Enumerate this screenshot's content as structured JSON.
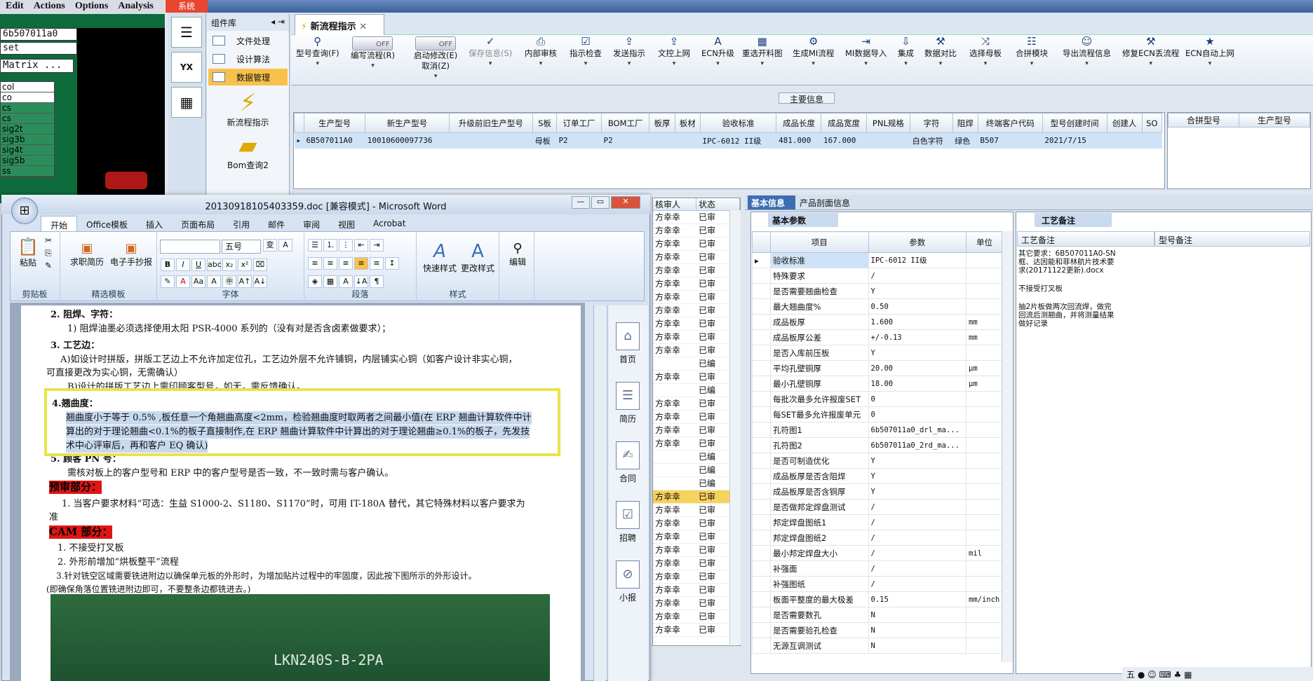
{
  "cam": {
    "menu": [
      "Edit",
      "Actions",
      "Options",
      "Analysis"
    ],
    "field1": "6b507011a0",
    "field2": "set",
    "field3": "Matrix ...",
    "layers": [
      "col",
      "co",
      "cs",
      "cs",
      "sig2t",
      "sig3b",
      "sig4t",
      "sig5b",
      "ss"
    ]
  },
  "app": {
    "sys_tab": "系统",
    "component_lib": "组件库",
    "items": [
      "文件处理",
      "设计算法",
      "数据管理"
    ],
    "big1": "新流程指示",
    "big2": "Bom查询2",
    "tab_title": "新流程指示"
  },
  "toolbar": [
    {
      "label": "型号查询(F)",
      "icon": "⚲"
    },
    {
      "label": "编写流程(R)",
      "icon": "toggle"
    },
    {
      "label": "启动修改(E)",
      "sub": "取消(Z)",
      "icon": "toggle"
    },
    {
      "label": "保存信息(S)",
      "icon": "✓"
    },
    {
      "label": "内部审核",
      "icon": "⎙"
    },
    {
      "label": "指示检查",
      "icon": "☑"
    },
    {
      "label": "发送指示",
      "icon": "⇪"
    },
    {
      "label": "文控上网",
      "icon": "⇪"
    },
    {
      "label": "ECN升级",
      "icon": "A"
    },
    {
      "label": "重选开料图",
      "icon": "▦"
    },
    {
      "label": "生成MI流程",
      "icon": "⚙"
    },
    {
      "label": "MI数据导入",
      "icon": "⇥"
    },
    {
      "label": "集成",
      "icon": "⇩"
    },
    {
      "label": "数据对比",
      "icon": "⚒"
    },
    {
      "label": "选择母板",
      "icon": "⤨"
    },
    {
      "label": "合拼模块",
      "icon": "☷"
    },
    {
      "label": "导出流程信息",
      "icon": "☺"
    },
    {
      "label": "修复ECN丢流程",
      "icon": "⚒"
    },
    {
      "label": "ECN自动上网",
      "icon": "★"
    }
  ],
  "toggle_off": "OFF",
  "main_info": {
    "header": "主要信息",
    "columns": [
      "生产型号",
      "新生产型号",
      "升级前旧生产型号",
      "S板",
      "订单工厂",
      "BOM工厂",
      "板厚",
      "板材",
      "验收标准",
      "成品长度",
      "成品宽度",
      "PNL规格",
      "字符",
      "阻焊",
      "终端客户代码",
      "型号创建时间",
      "创建人",
      "SO"
    ],
    "row": [
      "6B507011A0",
      "10010600097736",
      "",
      "母板",
      "P2",
      "P2",
      "",
      "",
      "IPC-6012 II级",
      "481.000",
      "167.000",
      "",
      "白色字符",
      "绿色",
      "B507",
      "2021/7/15",
      "",
      ""
    ]
  },
  "merge": {
    "columns": [
      "合拼型号",
      "生产型号"
    ]
  },
  "reviewers": {
    "columns": [
      "核审人",
      "状态"
    ],
    "rows": [
      [
        "方幸幸",
        "已审"
      ],
      [
        "方幸幸",
        "已审"
      ],
      [
        "方幸幸",
        "已审"
      ],
      [
        "方幸幸",
        "已审"
      ],
      [
        "方幸幸",
        "已审"
      ],
      [
        "方幸幸",
        "已审"
      ],
      [
        "方幸幸",
        "已审"
      ],
      [
        "方幸幸",
        "已审"
      ],
      [
        "方幸幸",
        "已审"
      ],
      [
        "方幸幸",
        "已审"
      ],
      [
        "方幸幸",
        "已审"
      ],
      [
        "",
        "已编"
      ],
      [
        "方幸幸",
        "已审"
      ],
      [
        "",
        "已编"
      ],
      [
        "方幸幸",
        "已审"
      ],
      [
        "方幸幸",
        "已审"
      ],
      [
        "方幸幸",
        "已审"
      ],
      [
        "方幸幸",
        "已审"
      ],
      [
        "",
        "已编"
      ],
      [
        "",
        "已编"
      ],
      [
        "",
        "已编"
      ],
      [
        "方幸幸",
        "已审"
      ],
      [
        "方幸幸",
        "已审"
      ],
      [
        "方幸幸",
        "已审"
      ],
      [
        "方幸幸",
        "已审"
      ],
      [
        "方幸幸",
        "已审"
      ],
      [
        "方幸幸",
        "已审"
      ],
      [
        "方幸幸",
        "已审"
      ],
      [
        "方幸幸",
        "已审"
      ],
      [
        "方幸幸",
        "已审"
      ],
      [
        "方幸幸",
        "已审"
      ],
      [
        "方幸幸",
        "已审"
      ]
    ]
  },
  "right": {
    "tab_basic": "基本信息",
    "tab_product": "产品剖面信息",
    "basic_params": "基本参数",
    "cols": [
      "项目",
      "参数",
      "单位"
    ],
    "params": [
      [
        "验收标准",
        "IPC-6012 II级",
        ""
      ],
      [
        "特殊要求",
        "/",
        ""
      ],
      [
        "是否需要翘曲检查",
        "Y",
        ""
      ],
      [
        "最大翘曲度%",
        "0.50",
        ""
      ],
      [
        "成品板厚",
        "1.600",
        "mm"
      ],
      [
        "成品板厚公差",
        "+/-0.13",
        "mm"
      ],
      [
        "是否入库前压板",
        "Y",
        ""
      ],
      [
        "平均孔壁铜厚",
        "20.00",
        "μm"
      ],
      [
        "最小孔壁铜厚",
        "18.00",
        "μm"
      ],
      [
        "每批次最多允许报废SET",
        "0",
        ""
      ],
      [
        "每SET最多允许报废单元",
        "0",
        ""
      ],
      [
        "孔符图1",
        "6b507011a0_drl_ma...",
        ""
      ],
      [
        "孔符图2",
        "6b507011a0_2rd_ma...",
        ""
      ],
      [
        "是否可制造优化",
        "Y",
        ""
      ],
      [
        "成品板厚是否含阻焊",
        "Y",
        ""
      ],
      [
        "成品板厚是否含铜厚",
        "Y",
        ""
      ],
      [
        "是否做邦定焊盘测试",
        "/",
        ""
      ],
      [
        "邦定焊盘图纸1",
        "/",
        ""
      ],
      [
        "邦定焊盘图纸2",
        "/",
        ""
      ],
      [
        "最小邦定焊盘大小",
        "/",
        "mil"
      ],
      [
        "补强面",
        "/",
        ""
      ],
      [
        "补强图纸",
        "/",
        ""
      ],
      [
        "板面平整度的最大极差",
        "0.15",
        "mm/inch"
      ],
      [
        "是否需要数孔",
        "N",
        ""
      ],
      [
        "是否需要验孔检查",
        "N",
        ""
      ],
      [
        "无源互调测试",
        "N",
        ""
      ]
    ],
    "craft_note": "工艺备注",
    "craft_col1": "工艺备注",
    "craft_col2": "型号备注",
    "craft_text": [
      "其它要求：6B507011A0-SN框、达因能和菲林航片技术要求(20171122更新).docx",
      "不接受打叉板",
      "抽2片板做两次回流焊，做完回流后测翘曲，并将测量结果做好记录"
    ]
  },
  "word": {
    "title": "20130918105403359.doc [兼容模式] - Microsoft Word",
    "tabs": [
      "开始",
      "Office模板",
      "插入",
      "页面布局",
      "引用",
      "邮件",
      "审阅",
      "视图",
      "Acrobat"
    ],
    "groups": [
      "剪贴板",
      "精选模板",
      "字体",
      "段落",
      "样式",
      "编辑"
    ],
    "paste": "粘贴",
    "tpl1": "求职简历",
    "tpl2": "电子手抄报",
    "font_size": "五号",
    "quick_style": "快速样式",
    "change_style": "更改样式",
    "edit": "编辑",
    "lines": [
      "2.  阻焊、字符：",
      "1) 阻焊油墨必须选择使用太阳 PSR-4000 系列的（没有对是否含卤素做要求）；",
      "3. 工艺边：",
      "A)如设计时拼版，拼版工艺边上不允许加定位孔，工艺边外层不允许铺铜，内层铺实心铜（如客户设计非实心铜，",
      "可直接更改为实心铜，无需确认）",
      "B)设计的拼版工艺边上需印顾客型号，如无，需反馈确认。",
      "4.翘曲度：",
      "翘曲度小于等于 0.5% ,板任意一个角翘曲高度<2mm，检验翘曲度时取两者之间最小值(在 ERP 翘曲计算软件中计",
      "算出的对于理论翘曲<0.1%的板子直接制作,在 ERP 翘曲计算软件中计算出的对于理论翘曲≥0.1%的板子，先发技",
      "术中心评审后，再和客户 EQ 确认)",
      "5. 顾客 PN 号：",
      "需核对板上的客户型号和 ERP 中的客户型号是否一致，不一致时需与客户确认。",
      "预审部分：",
      "1. 当客户要求材料“可选：生益 S1000-2、S1180、S1170”时，可用 IT-180A 替代，其它特殊材料以客户要求为",
      "准",
      "CAM 部分：",
      "1. 不接受打叉板",
      "2. 外形前增加“烘板整平”流程",
      "3.针对铣空区域需要铣进附边以确保单元板的外形时，为增加贴片过程中的牢固度，因此按下图所示的外形设计。",
      "(即确保角落位置铣进附边即可，不要整条边都铣进去。)"
    ],
    "photo_label": "LKN240S-B-2PA",
    "side": [
      "首页",
      "简历",
      "合同",
      "招聘",
      "小报"
    ]
  },
  "status": "五"
}
